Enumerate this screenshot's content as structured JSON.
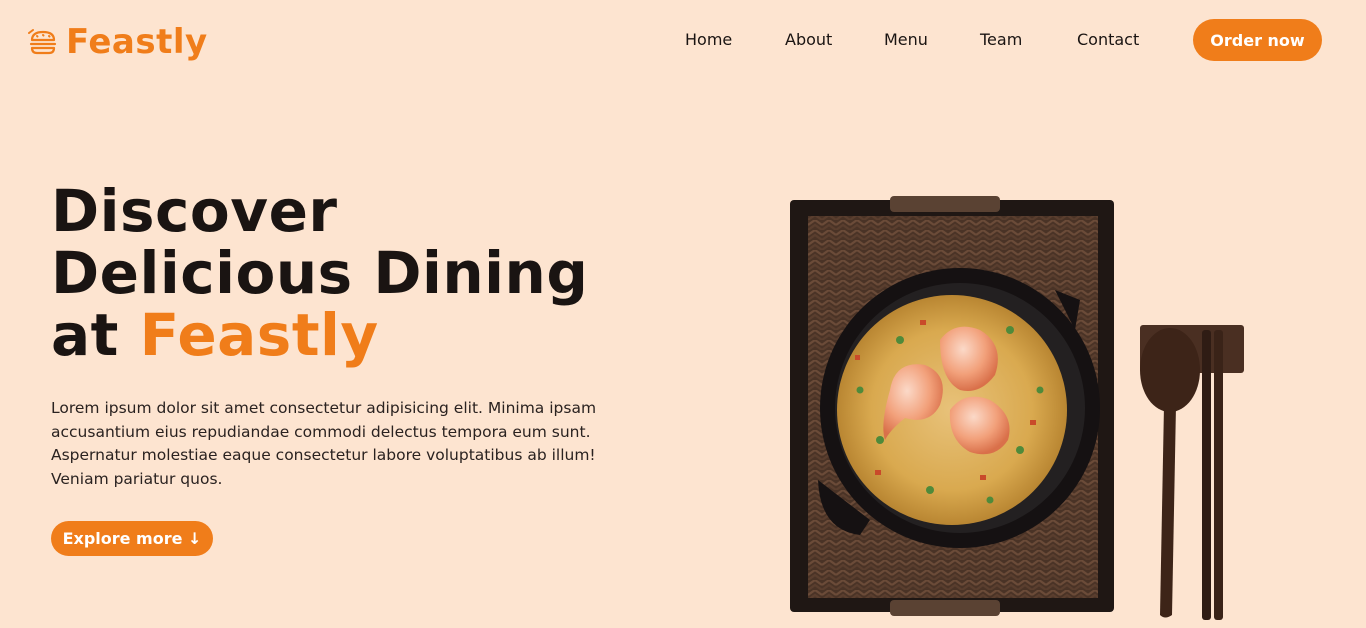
{
  "brand": {
    "name": "Feastly",
    "color": "#f07d1a"
  },
  "nav": {
    "items": [
      {
        "label": "Home"
      },
      {
        "label": "About"
      },
      {
        "label": "Menu"
      },
      {
        "label": "Team"
      },
      {
        "label": "Contact"
      }
    ],
    "cta_label": "Order now"
  },
  "hero": {
    "title_line1": "Discover",
    "title_line2": "Delicious Dining",
    "title_line3_prefix": "at ",
    "title_line3_accent": "Feastly",
    "description": "Lorem ipsum dolor sit amet consectetur adipisicing elit. Minima ipsam accusantium eius repudiandae commodi delectus tempora eum sunt. Aspernatur molestiae eaque consectetur labore voluptatibus ab illum! Veniam pariatur quos.",
    "button_label": "Explore more ↓"
  },
  "image": {
    "subject": "shrimp-fried-rice-bowl"
  },
  "colors": {
    "background": "#fde4d0",
    "accent": "#f07d1a",
    "text": "#1a1412"
  }
}
